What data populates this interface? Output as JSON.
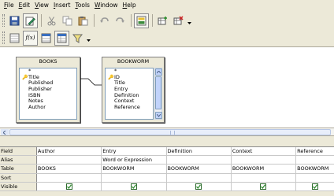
{
  "menu": [
    {
      "pre": "",
      "u": "F",
      "post": "ile"
    },
    {
      "pre": "",
      "u": "E",
      "post": "dit"
    },
    {
      "pre": "",
      "u": "V",
      "post": "iew"
    },
    {
      "pre": "",
      "u": "I",
      "post": "nsert"
    },
    {
      "pre": "",
      "u": "T",
      "post": "ools"
    },
    {
      "pre": "",
      "u": "W",
      "post": "indow"
    },
    {
      "pre": "",
      "u": "H",
      "post": "elp"
    }
  ],
  "toolbar1": [
    "save-icon",
    "edit-icon",
    "cut-icon",
    "copy-icon",
    "paste-icon",
    "undo-icon",
    "redo-icon",
    "design-view-icon",
    "add-table-icon",
    "delete-table-icon"
  ],
  "toolbar2": [
    "switch-design-icon",
    "function-icon",
    "table-name-icon",
    "alias-icon",
    "distinct-values-icon"
  ],
  "toolbar2_function_label": "f(x)",
  "tables": {
    "books": {
      "title": "BOOKS",
      "fields": [
        "*",
        "Title",
        "Published",
        "Publisher",
        "ISBN",
        "Notes",
        "Author"
      ],
      "key_field": "Title"
    },
    "bookworm": {
      "title": "BOOKWORM",
      "fields": [
        "*",
        "ID",
        "Title",
        "Entry",
        "Definition",
        "Context",
        "Reference"
      ],
      "key_field": "ID"
    }
  },
  "grid": {
    "row_labels": [
      "Field",
      "Alias",
      "Table",
      "Sort",
      "Visible"
    ],
    "columns": [
      {
        "field": "Author",
        "alias": "",
        "table": "BOOKS",
        "sort": "",
        "visible": true
      },
      {
        "field": "Entry",
        "alias": "Word or Expression",
        "table": "BOOKWORM",
        "sort": "",
        "visible": true
      },
      {
        "field": "Definition",
        "alias": "",
        "table": "BOOKWORM",
        "sort": "",
        "visible": true
      },
      {
        "field": "Context",
        "alias": "",
        "table": "BOOKWORM",
        "sort": "",
        "visible": true
      },
      {
        "field": "Reference",
        "alias": "",
        "table": "BOOKWORM",
        "sort": "",
        "visible": true
      }
    ]
  },
  "colors": {
    "background": "#ece9d8",
    "design_area": "#ffffff",
    "checkbox_green": "#2d8a2d",
    "scroll_blue": "#c1d3fb"
  }
}
